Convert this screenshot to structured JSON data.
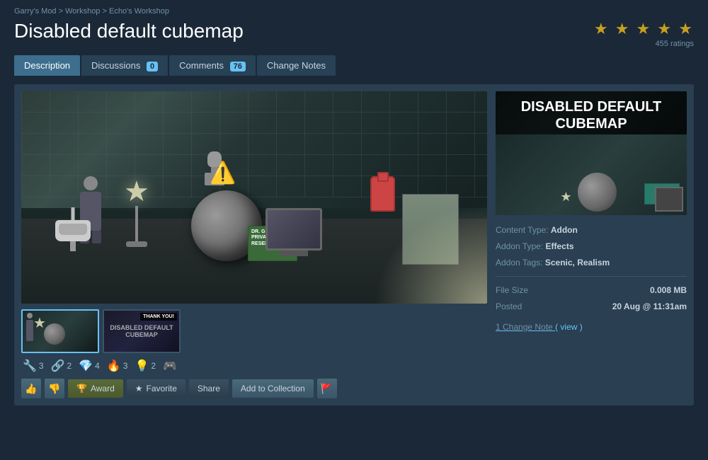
{
  "breadcrumb": {
    "items": [
      {
        "label": "Garry's Mod",
        "url": "#"
      },
      {
        "separator": ">"
      },
      {
        "label": "Workshop",
        "url": "#"
      },
      {
        "separator": ">"
      },
      {
        "label": "Echo's Workshop",
        "url": "#"
      }
    ],
    "text": "Garry's Mod > Workshop > Echo's Workshop"
  },
  "title": "Disabled default cubemap",
  "rating": {
    "stars": 4.5,
    "count": "455 ratings",
    "display": "★★★★★"
  },
  "tabs": [
    {
      "id": "description",
      "label": "Description",
      "active": true,
      "badge": null
    },
    {
      "id": "discussions",
      "label": "Discussions",
      "active": false,
      "badge": "0"
    },
    {
      "id": "comments",
      "label": "Comments",
      "active": false,
      "badge": "76"
    },
    {
      "id": "changenotes",
      "label": "Change Notes",
      "active": false,
      "badge": null
    }
  ],
  "preview_title": "DISABLED DEFAULT CUBEMAP",
  "meta": {
    "content_type_label": "Content Type:",
    "content_type_value": "Addon",
    "addon_type_label": "Addon Type:",
    "addon_type_value": "Effects",
    "addon_tags_label": "Addon Tags:",
    "addon_tags_value": "Scenic, Realism",
    "file_size_label": "File Size",
    "file_size_value": "0.008 MB",
    "posted_label": "Posted",
    "posted_value": "20 Aug @ 11:31am",
    "change_note_text": "1 Change Note",
    "change_note_link": "( view )"
  },
  "reactions": [
    {
      "icon": "🔧",
      "count": "3"
    },
    {
      "icon": "🔗",
      "count": "2"
    },
    {
      "icon": "💎",
      "count": "4"
    },
    {
      "icon": "🔥",
      "count": "3"
    },
    {
      "icon": "💡",
      "count": "2"
    },
    {
      "icon": "🎮",
      "count": ""
    }
  ],
  "actions": [
    {
      "id": "thumbs-up",
      "label": "👍",
      "type": "icon"
    },
    {
      "id": "thumbs-down",
      "label": "👎",
      "type": "icon"
    },
    {
      "id": "award",
      "label": "Award",
      "icon": "🏆",
      "type": "btn-award"
    },
    {
      "id": "favorite",
      "label": "Favorite",
      "icon": "★",
      "type": "btn-dark"
    },
    {
      "id": "share",
      "label": "Share",
      "type": "btn-dark"
    },
    {
      "id": "add-to-collection",
      "label": "Add to Collection",
      "type": "btn-gray"
    },
    {
      "id": "flag",
      "label": "🚩",
      "type": "icon"
    }
  ]
}
